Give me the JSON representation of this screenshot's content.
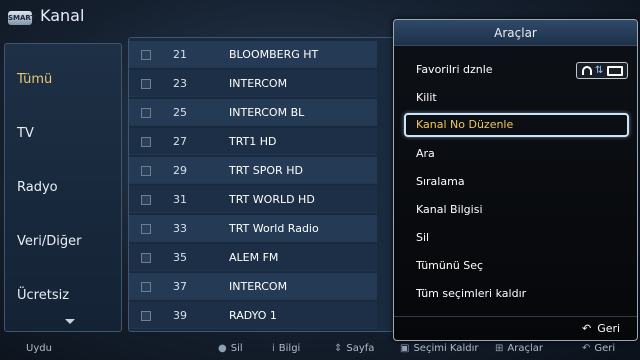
{
  "header": {
    "title": "Kanal",
    "logo_text": "SMART"
  },
  "categories": [
    "Tümü",
    "TV",
    "Radyo",
    "Veri/Diğer",
    "Ücretsiz"
  ],
  "channels": [
    {
      "number": "21",
      "name": "BLOOMBERG HT"
    },
    {
      "number": "23",
      "name": "INTERCOM"
    },
    {
      "number": "25",
      "name": "INTERCOM BL"
    },
    {
      "number": "27",
      "name": "TRT1 HD"
    },
    {
      "number": "29",
      "name": "TRT SPOR HD"
    },
    {
      "number": "31",
      "name": "TRT WORLD HD"
    },
    {
      "number": "33",
      "name": "TRT World Radio"
    },
    {
      "number": "35",
      "name": "ALEM FM"
    },
    {
      "number": "37",
      "name": "INTERCOM"
    },
    {
      "number": "39",
      "name": "RADYO 1"
    }
  ],
  "tools": {
    "title": "Araçlar",
    "items": [
      "Favorilri dznle",
      "Kilit",
      "Kanal No Düzenle",
      "Ara",
      "Sıralama",
      "Kanal Bilgisi",
      "Sil",
      "Tümünü Seç",
      "Tüm seçimleri kaldır"
    ],
    "selected_index": 2,
    "back_label": "Geri",
    "back_icon": "return-arrow-icon",
    "favorite_indicator_icons": [
      "headphone-icon",
      "swap-icon",
      "tv-icon"
    ]
  },
  "help_bar": [
    {
      "icon": "remote-button-icon",
      "label": "Uydu"
    },
    {
      "icon": "red-button-icon",
      "label": "Sil"
    },
    {
      "icon": "info-icon",
      "label": "Bilgi"
    },
    {
      "icon": "page-icon",
      "label": "Sayfa"
    },
    {
      "icon": "deselect-icon",
      "label": "Seçimi Kaldır"
    },
    {
      "icon": "tools-icon",
      "label": "Araçlar"
    },
    {
      "icon": "return-icon",
      "label": "Geri"
    }
  ],
  "colors": {
    "selected_text": "#f2c75c",
    "active_category": "#e7c66e",
    "popup_header": "#2f4a68"
  }
}
